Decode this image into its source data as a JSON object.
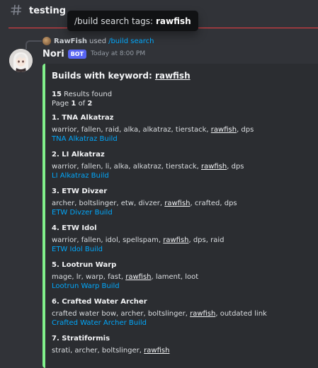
{
  "channel": {
    "name": "testing",
    "icon": "hash-icon"
  },
  "tooltip": {
    "prefix": "/build search tags:",
    "value": "rawfish"
  },
  "reply": {
    "user": "RawFish",
    "used": "used",
    "command": "/build search"
  },
  "message": {
    "author": "Nori",
    "badge": "BOT",
    "timestamp": "Today at 8:00 PM"
  },
  "embed": {
    "accent_color": "#81f08b",
    "title_prefix": "Builds with keyword:",
    "title_keyword": "rawfish",
    "results_count": "15",
    "results_label": "Results found",
    "page_label": "Page",
    "page_current": "1",
    "page_of": "of",
    "page_total": "2",
    "builds": [
      {
        "name": "1. TNA Alkatraz",
        "tags_before": "warrior, fallen, raid, alka, alkatraz, tierstack, ",
        "keyword": "rawfish",
        "tags_after": ", dps",
        "link": "TNA Alkatraz Build"
      },
      {
        "name": "2. LI Alkatraz",
        "tags_before": "warrior, fallen, li, alka, alkatraz, tierstack, ",
        "keyword": "rawfish",
        "tags_after": ", dps",
        "link": "LI Alkatraz Build"
      },
      {
        "name": "3. ETW Divzer",
        "tags_before": "archer, boltslinger, etw, divzer, ",
        "keyword": "rawfish",
        "tags_after": ", crafted, dps",
        "link": "ETW Divzer Build"
      },
      {
        "name": "4. ETW Idol",
        "tags_before": "warrior, fallen, idol, spellspam, ",
        "keyword": "rawfish",
        "tags_after": ", dps, raid",
        "link": "ETW Idol Build"
      },
      {
        "name": "5. Lootrun Warp",
        "tags_before": "mage, lr, warp, fast, ",
        "keyword": "rawfish",
        "tags_after": ", lament, loot",
        "link": "Lootrun Warp Build"
      },
      {
        "name": "6. Crafted Water Archer",
        "tags_before": "crafted water bow, archer, boltslinger, ",
        "keyword": "rawfish",
        "tags_after": ", outdated link",
        "link": "Crafted Water Archer Build"
      },
      {
        "name": "7. Stratiformis",
        "tags_before": "strati, archer, boltslinger, ",
        "keyword": "rawfish",
        "tags_after": "",
        "link": ""
      }
    ]
  }
}
